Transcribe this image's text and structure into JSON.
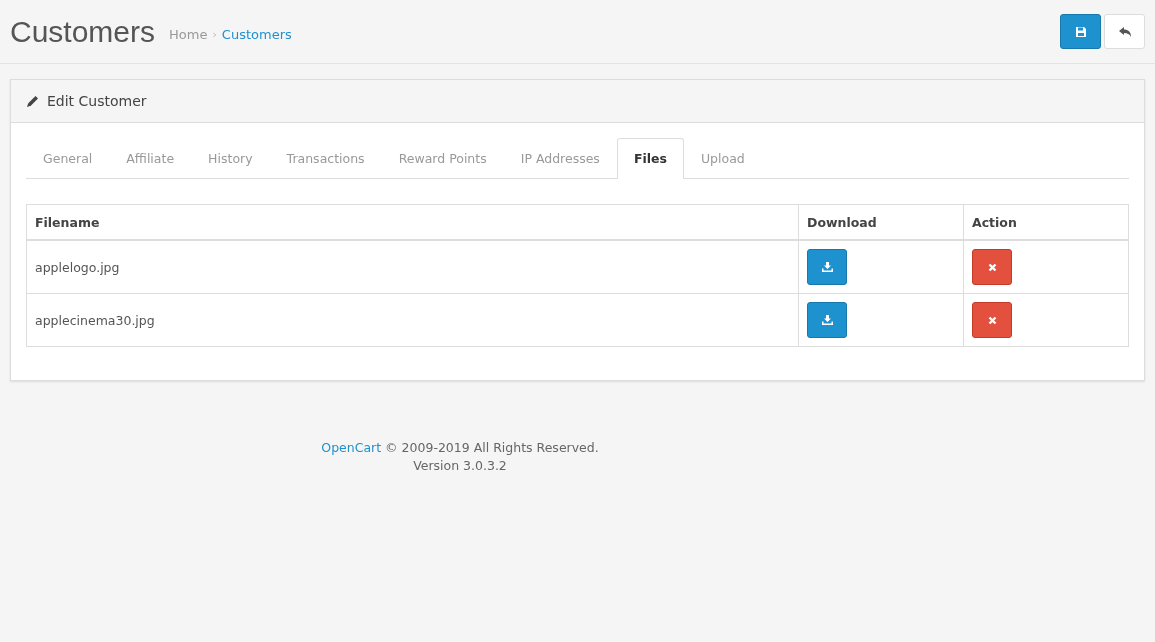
{
  "page_title": "Customers",
  "breadcrumb": [
    {
      "label": "Home",
      "current": false
    },
    {
      "separator": "›"
    },
    {
      "label": "Customers",
      "current": true
    }
  ],
  "header_buttons": [
    {
      "kind": "save"
    },
    {
      "kind": "back"
    }
  ],
  "panel": {
    "title": "Edit Customer",
    "tabs": [
      {
        "label": "General",
        "selected": false
      },
      {
        "label": "Affiliate",
        "selected": false
      },
      {
        "label": "History",
        "selected": false
      },
      {
        "label": "Transactions",
        "selected": false
      },
      {
        "label": "Reward Points",
        "selected": false
      },
      {
        "label": "IP Addresses",
        "selected": false
      },
      {
        "label": "Files",
        "selected": true
      },
      {
        "label": "Upload",
        "selected": false
      }
    ],
    "table": {
      "columns": [
        "Filename",
        "Download",
        "Action"
      ],
      "rows": [
        {
          "filename": "applelogo.jpg"
        },
        {
          "filename": "applecinema30.jpg"
        }
      ]
    }
  },
  "footer": {
    "link": "OpenCart",
    "text": " © 2009-2019 All Rights Reserved.",
    "version": "Version 3.0.3.2"
  }
}
